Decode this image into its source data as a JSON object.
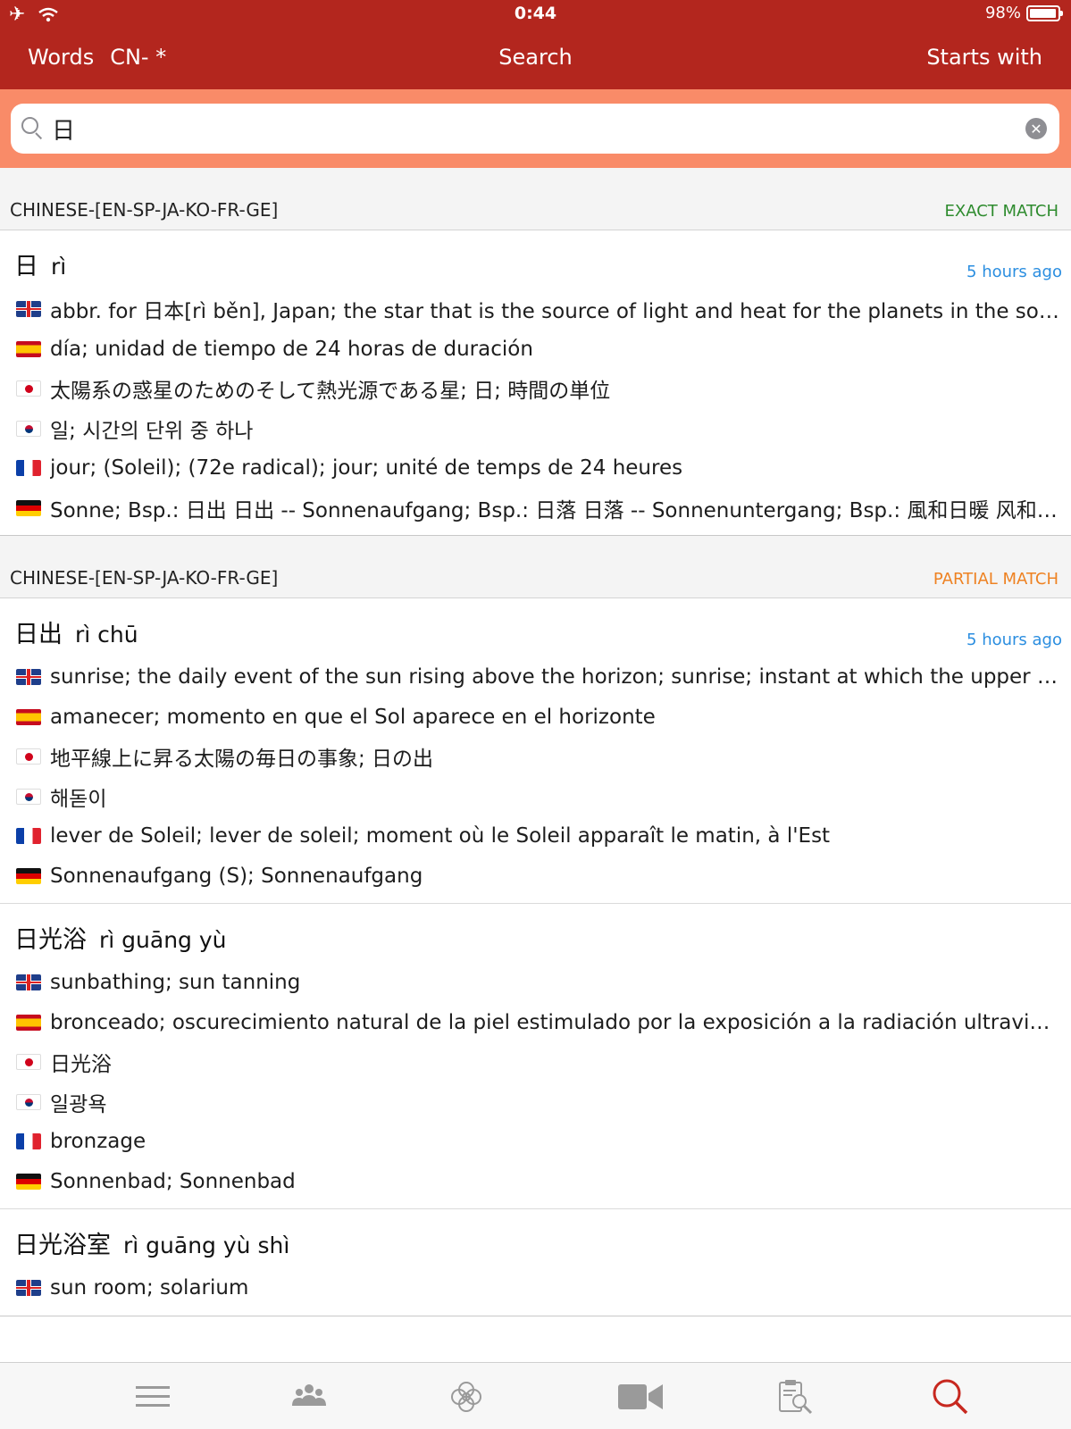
{
  "status": {
    "time": "0:44",
    "battery": "98%"
  },
  "nav": {
    "words_label": "Words",
    "lang_label": "CN- *",
    "title": "Search",
    "mode_label": "Starts with"
  },
  "search": {
    "value": "日"
  },
  "sections": [
    {
      "title": "CHINESE-[EN-SP-JA-KO-FR-GE]",
      "match": "EXACT MATCH",
      "entries": [
        {
          "headword": "日",
          "pinyin": "rì",
          "time": "5 hours ago",
          "translations": [
            {
              "flag": "gb-flag-icon",
              "text": "abbr. for 日本[rì běn], Japan; the star that is the source of light and heat for the planets in the solar…"
            },
            {
              "flag": "es-flag-icon",
              "text": "día; unidad de tiempo de 24 horas de duración"
            },
            {
              "flag": "jp-flag-icon",
              "text": "太陽系の惑星のためのそして熱光源である星; 日; 時間の単位"
            },
            {
              "flag": "kr-flag-icon",
              "text": "일; 시간의 단위 중 하나"
            },
            {
              "flag": "fr-flag-icon",
              "text": "jour; (Soleil); (72e radical); jour; unité de temps de 24 heures"
            },
            {
              "flag": "de-flag-icon",
              "text": "Sonne; Bsp.: 日出 日出 -- Sonnenaufgang; Bsp.: 日落 日落 -- Sonnenuntergang; Bsp.: 風和日暖 风和…"
            }
          ]
        }
      ]
    },
    {
      "title": "CHINESE-[EN-SP-JA-KO-FR-GE]",
      "match": "PARTIAL MATCH",
      "entries": [
        {
          "headword": "日出",
          "pinyin": "rì chū",
          "time": "5 hours ago",
          "translations": [
            {
              "flag": "gb-flag-icon",
              "text": "sunrise; the daily event of the sun rising above the horizon; sunrise; instant at which the upper edge…"
            },
            {
              "flag": "es-flag-icon",
              "text": "amanecer; momento en que el Sol aparece en el horizonte"
            },
            {
              "flag": "jp-flag-icon",
              "text": "地平線上に昇る太陽の毎日の事象; 日の出"
            },
            {
              "flag": "kr-flag-icon",
              "text": "해돋이"
            },
            {
              "flag": "fr-flag-icon",
              "text": "lever de Soleil; lever de soleil; moment où le Soleil apparaît le matin, à l'Est"
            },
            {
              "flag": "de-flag-icon",
              "text": "Sonnenaufgang (S); Sonnenaufgang"
            }
          ]
        },
        {
          "headword": "日光浴",
          "pinyin": "rì guāng yù",
          "time": "",
          "translations": [
            {
              "flag": "gb-flag-icon",
              "text": "sunbathing; sun tanning"
            },
            {
              "flag": "es-flag-icon",
              "text": "bronceado; oscurecimiento natural de la piel estimulado por la exposición a la radiación ultravioleta"
            },
            {
              "flag": "jp-flag-icon",
              "text": "日光浴"
            },
            {
              "flag": "kr-flag-icon",
              "text": "일광욕"
            },
            {
              "flag": "fr-flag-icon",
              "text": "bronzage"
            },
            {
              "flag": "de-flag-icon",
              "text": "Sonnenbad; Sonnenbad"
            }
          ]
        },
        {
          "headword": "日光浴室",
          "pinyin": "rì guāng yù shì",
          "time": "",
          "translations": [
            {
              "flag": "gb-flag-icon",
              "text": "sun room; solarium"
            }
          ]
        }
      ]
    }
  ],
  "tabs": [
    {
      "icon": "menu-icon"
    },
    {
      "icon": "community-icon"
    },
    {
      "icon": "flower-icon"
    },
    {
      "icon": "video-icon"
    },
    {
      "icon": "clipboard-search-icon"
    },
    {
      "icon": "search-icon",
      "active": true
    }
  ],
  "colors": {
    "bar": "#b3261e",
    "search_band": "#f98b68",
    "exact": "#2e8b2e",
    "partial": "#ee8222",
    "link": "#2b8ee0",
    "active_tab": "#c7281f",
    "inactive_tab": "#9a9a9a"
  }
}
